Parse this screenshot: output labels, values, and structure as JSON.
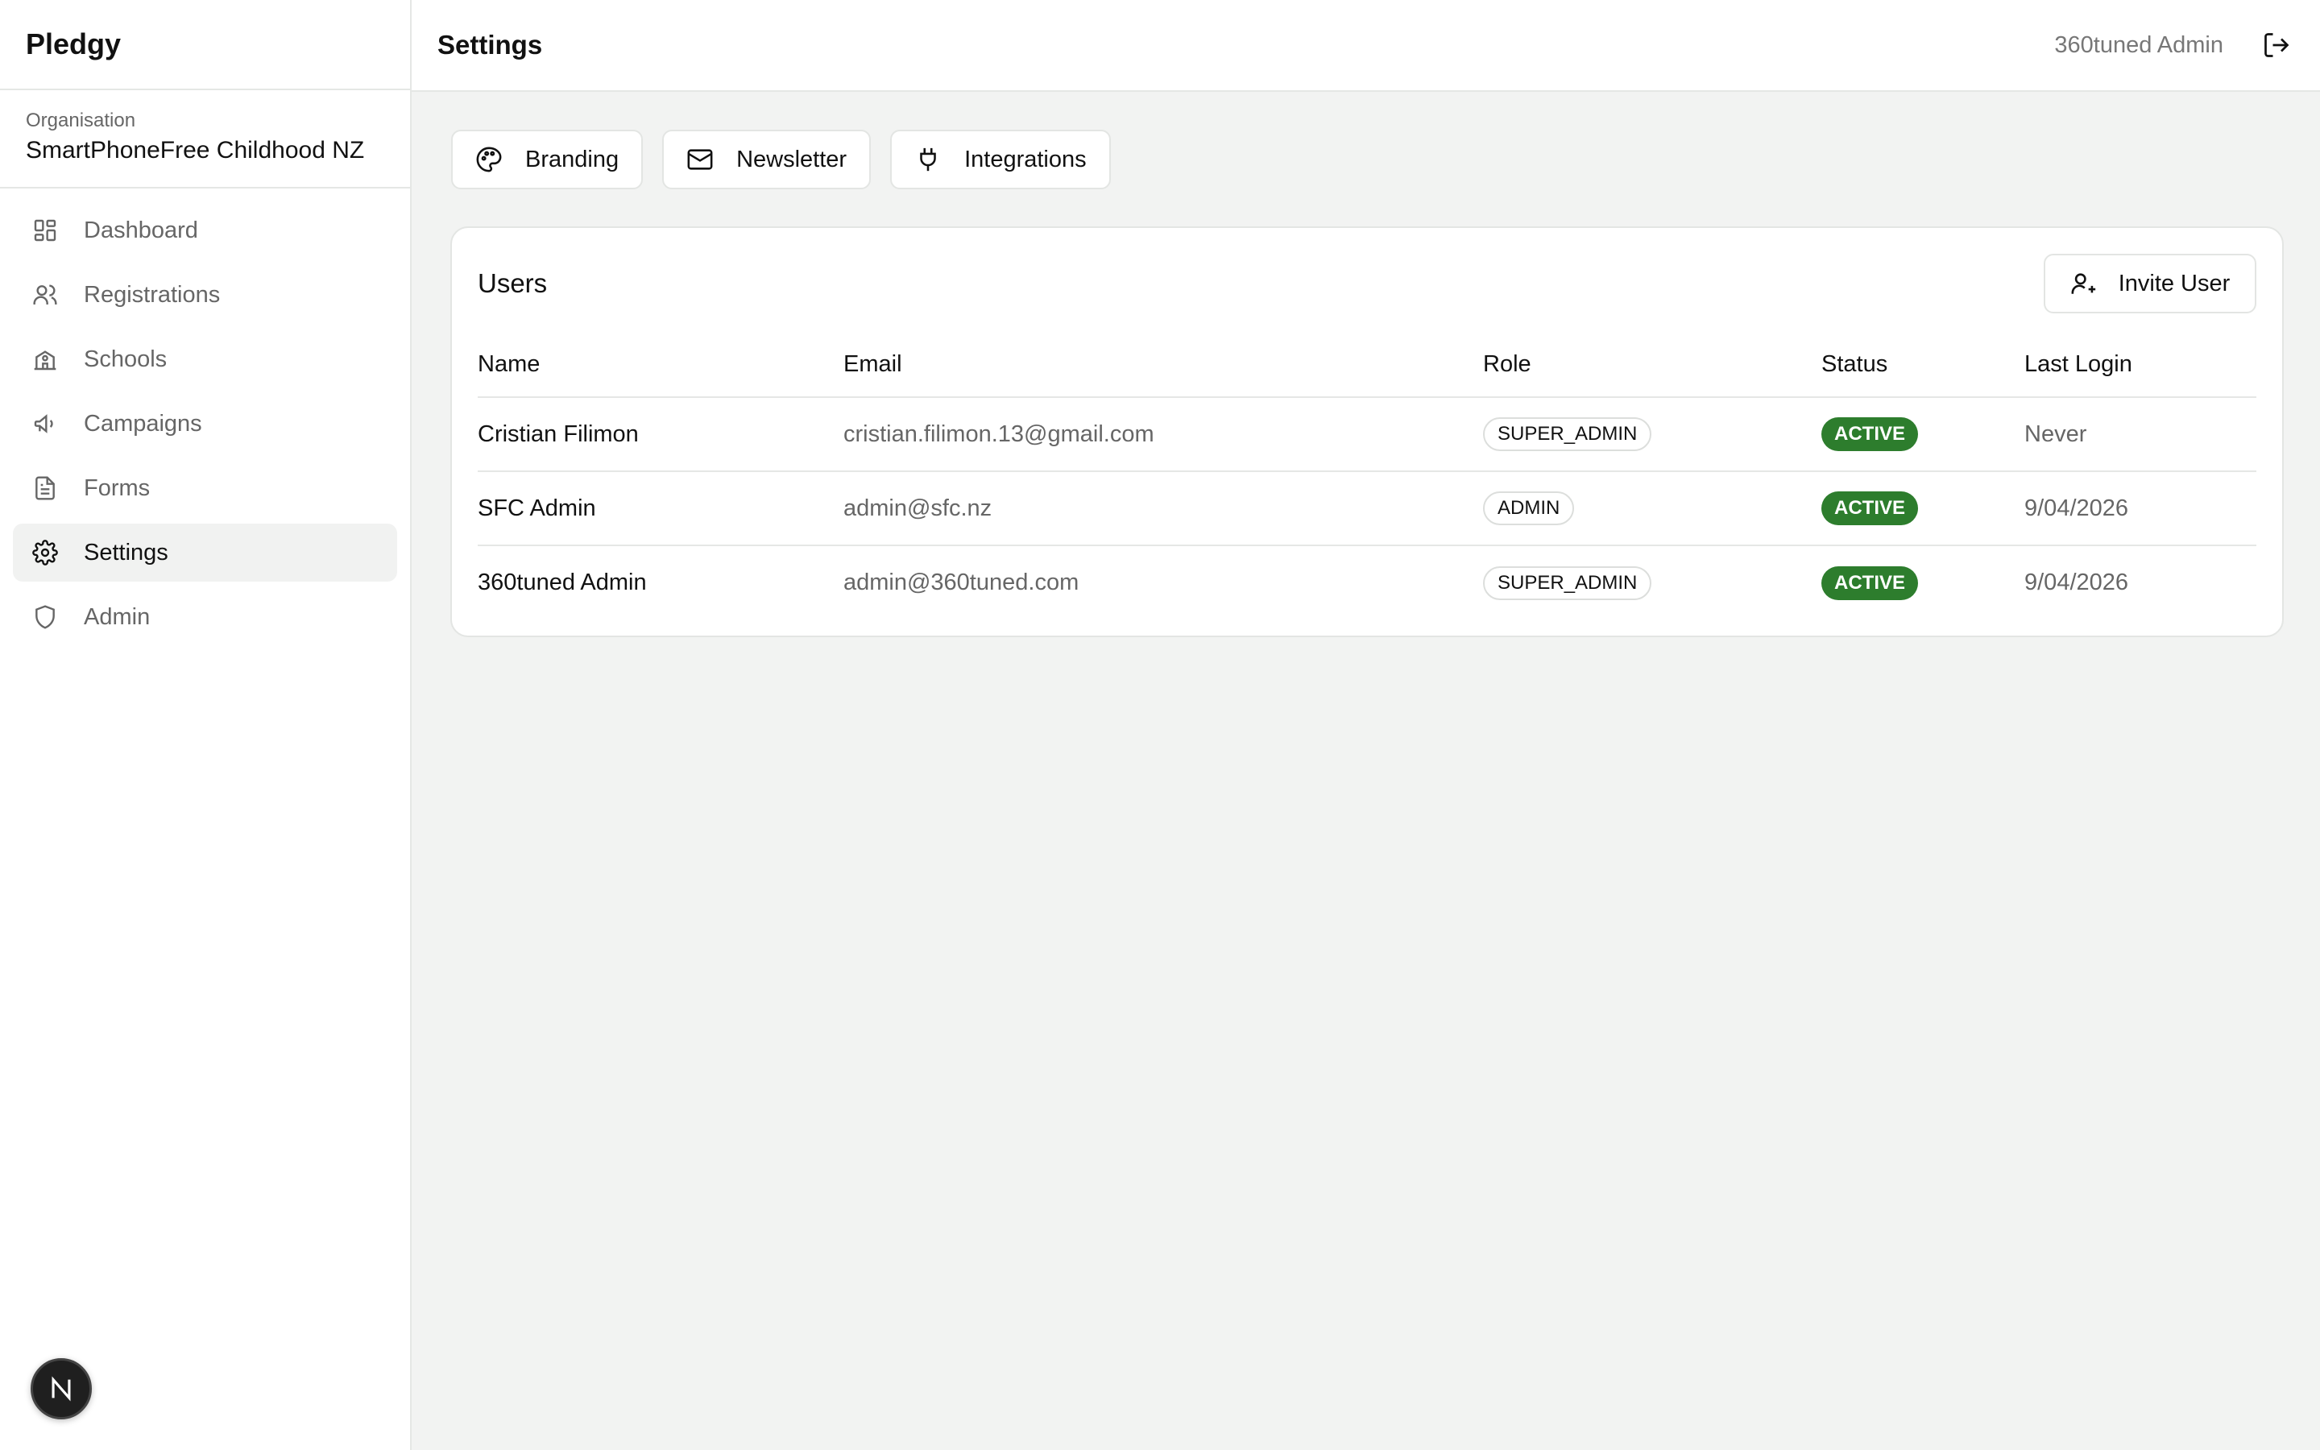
{
  "app": {
    "brand": "Pledgy"
  },
  "organisation": {
    "label": "Organisation",
    "name": "SmartPhoneFree Childhood NZ"
  },
  "sidebar": {
    "items": [
      {
        "label": "Dashboard",
        "icon": "dashboard-icon"
      },
      {
        "label": "Registrations",
        "icon": "users-icon"
      },
      {
        "label": "Schools",
        "icon": "school-icon"
      },
      {
        "label": "Campaigns",
        "icon": "megaphone-icon"
      },
      {
        "label": "Forms",
        "icon": "file-text-icon"
      },
      {
        "label": "Settings",
        "icon": "gear-icon",
        "active": true
      },
      {
        "label": "Admin",
        "icon": "shield-icon"
      }
    ]
  },
  "header": {
    "title": "Settings",
    "user": "360tuned Admin"
  },
  "tabs": [
    {
      "label": "Branding",
      "icon": "palette-icon"
    },
    {
      "label": "Newsletter",
      "icon": "mail-icon"
    },
    {
      "label": "Integrations",
      "icon": "plug-icon"
    }
  ],
  "users_card": {
    "title": "Users",
    "invite_label": "Invite User",
    "columns": [
      "Name",
      "Email",
      "Role",
      "Status",
      "Last Login"
    ],
    "rows": [
      {
        "name": "Cristian Filimon",
        "email": "cristian.filimon.13@gmail.com",
        "role": "SUPER_ADMIN",
        "status": "ACTIVE",
        "last_login": "Never"
      },
      {
        "name": "SFC Admin",
        "email": "admin@sfc.nz",
        "role": "ADMIN",
        "status": "ACTIVE",
        "last_login": "9/04/2026"
      },
      {
        "name": "360tuned Admin",
        "email": "admin@360tuned.com",
        "role": "SUPER_ADMIN",
        "status": "ACTIVE",
        "last_login": "9/04/2026"
      }
    ]
  },
  "colors": {
    "active_status": "#2d7d2d",
    "background": "#f2f3f2",
    "sidebar_active": "#f1f2f1"
  }
}
